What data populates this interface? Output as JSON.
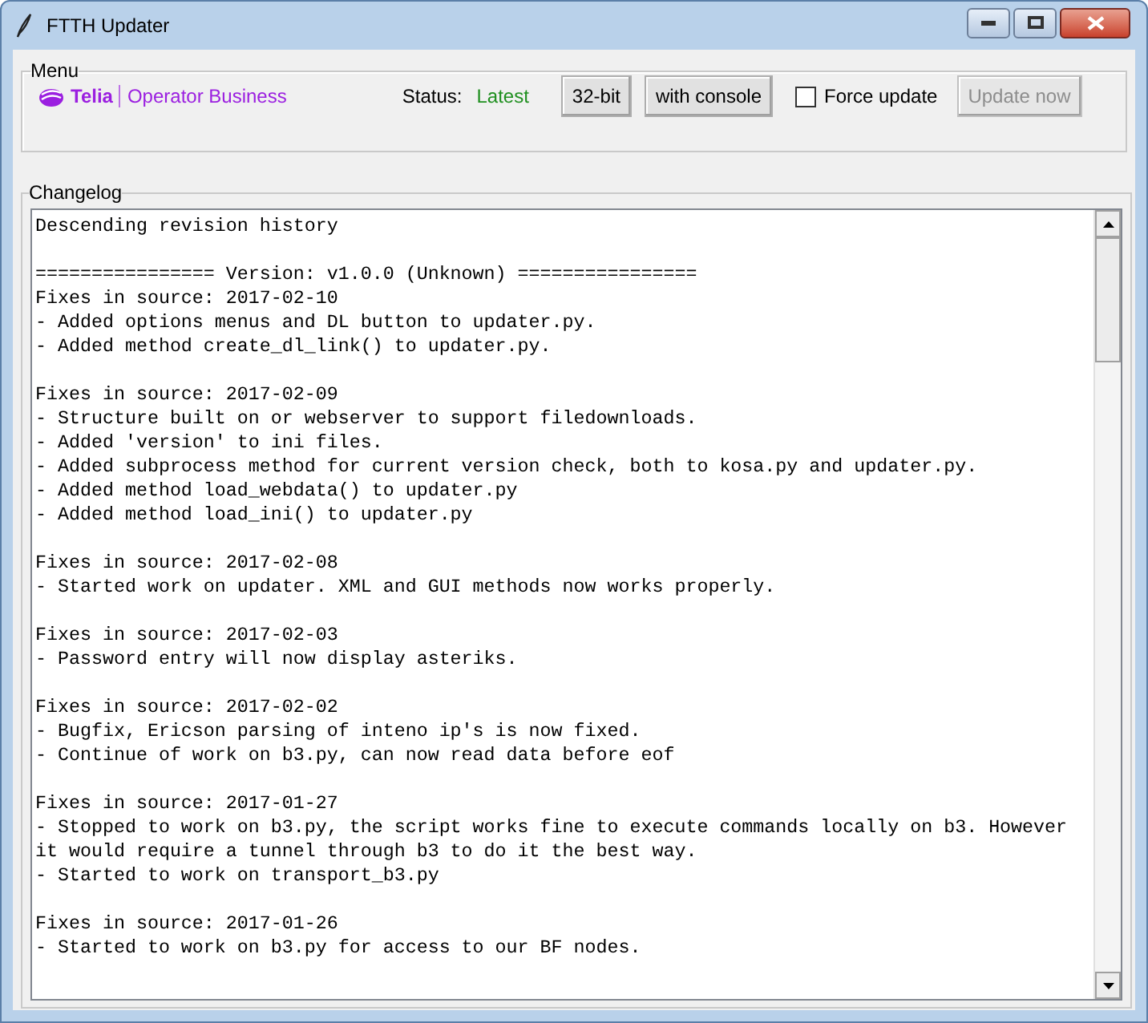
{
  "window": {
    "title": "FTTH Updater"
  },
  "menu": {
    "label": "Menu",
    "logo": {
      "brand": "Telia",
      "tagline": "Operator Business"
    },
    "status_label": "Status:",
    "status": "Latest",
    "buttons": [
      {
        "label": "32-bit",
        "disabled": false
      },
      {
        "label": "with console",
        "disabled": false
      }
    ],
    "force_update": {
      "label": "Force update",
      "checked": false
    },
    "update_button": {
      "label": "Update now",
      "disabled": true
    }
  },
  "changelog": {
    "label": "Changelog",
    "intro": "Descending revision history",
    "version_line": "================ Version: v1.0.0 (Unknown) ================",
    "sections": [
      {
        "title": "Fixes in source: 2017-02-10",
        "items": [
          "- Added options menus and DL button to updater.py.",
          "- Added method create_dl_link() to updater.py."
        ]
      },
      {
        "title": "Fixes in source: 2017-02-09",
        "items": [
          "- Structure built on or webserver to support filedownloads.",
          "- Added 'version' to ini files.",
          "- Added subprocess method for current version check, both to kosa.py and updater.py.",
          "- Added method load_webdata() to updater.py",
          "- Added method load_ini() to updater.py"
        ]
      },
      {
        "title": "Fixes in source: 2017-02-08",
        "items": [
          "- Started work on updater. XML and GUI methods now works properly."
        ]
      },
      {
        "title": "Fixes in source: 2017-02-03",
        "items": [
          "- Password entry will now display asteriks."
        ]
      },
      {
        "title": "Fixes in source: 2017-02-02",
        "items": [
          "- Bugfix, Ericson parsing of inteno ip's is now fixed.",
          "- Continue of work on b3.py, can now read data before eof"
        ]
      },
      {
        "title": "Fixes in source: 2017-01-27",
        "items": [
          "- Stopped to work on b3.py, the script works fine to execute commands locally on b3. However it would require a tunnel through b3 to do it the best way.",
          "- Started to work on transport_b3.py"
        ]
      },
      {
        "title": "Fixes in source: 2017-01-26",
        "items": [
          "- Started to work on b3.py for access to our BF nodes."
        ]
      }
    ]
  }
}
